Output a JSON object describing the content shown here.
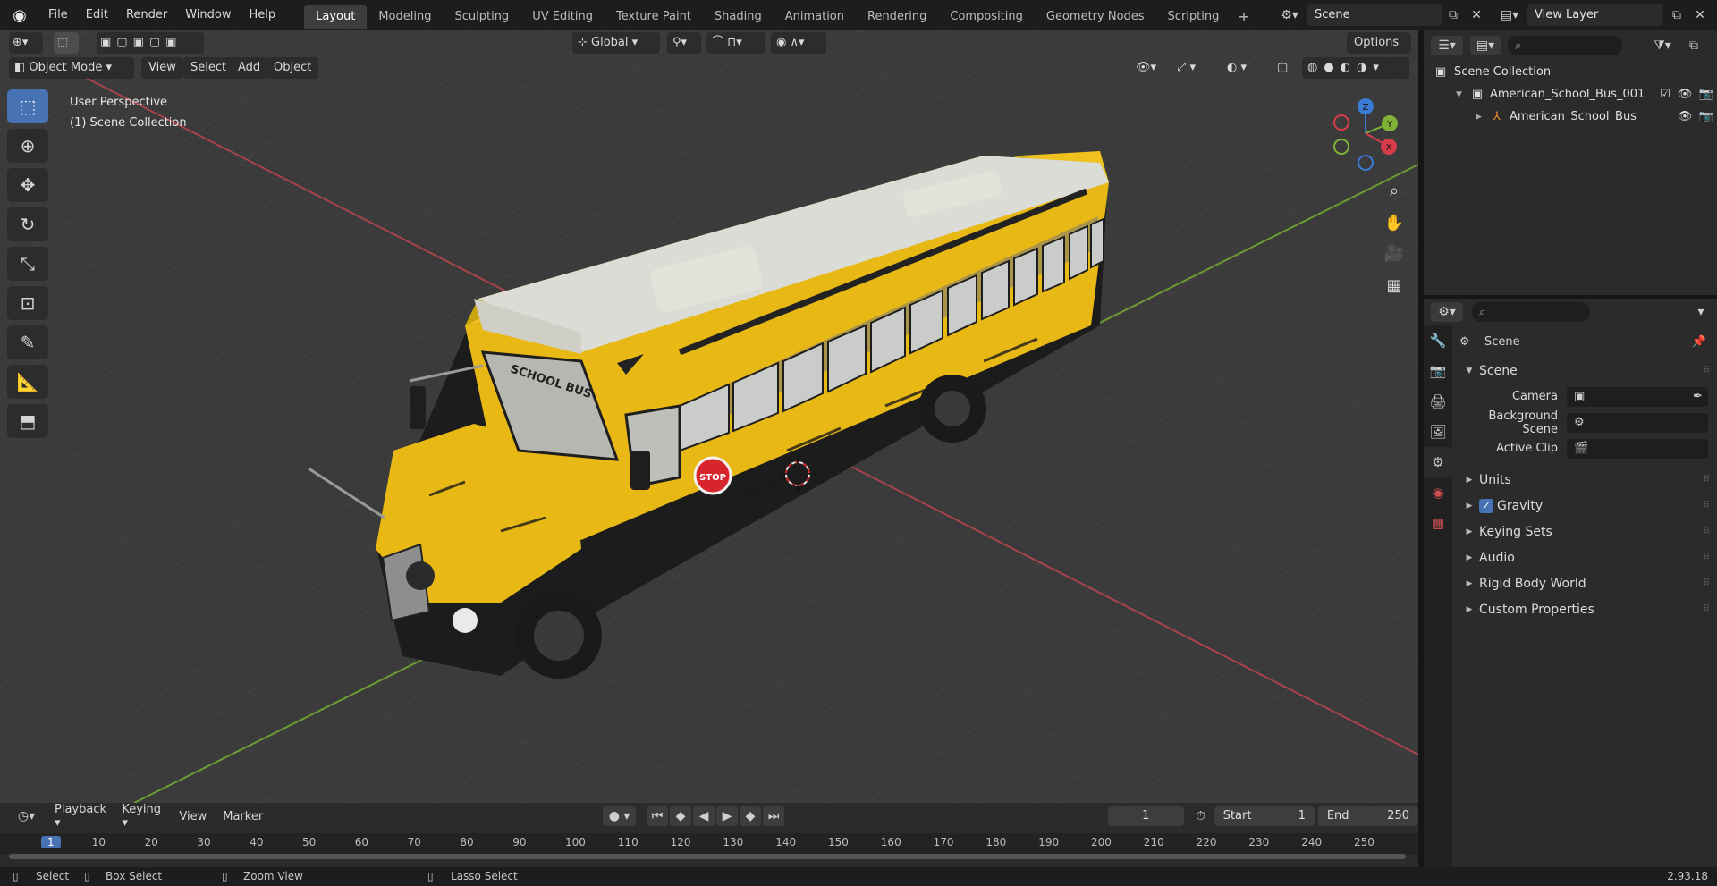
{
  "menu": [
    "File",
    "Edit",
    "Render",
    "Window",
    "Help"
  ],
  "workspaces": [
    "Layout",
    "Modeling",
    "Sculpting",
    "UV Editing",
    "Texture Paint",
    "Shading",
    "Animation",
    "Rendering",
    "Compositing",
    "Geometry Nodes",
    "Scripting"
  ],
  "active_workspace": "Layout",
  "scene_name": "Scene",
  "view_layer": "View Layer",
  "viewport": {
    "transform_orientation": "Global",
    "options_label": "Options",
    "mode": "Object Mode",
    "header_menu": [
      "View",
      "Select",
      "Add",
      "Object"
    ],
    "overlay_title": "User Perspective",
    "overlay_collection": "(1) Scene Collection",
    "axis": {
      "x": "X",
      "y": "Y",
      "z": "Z"
    }
  },
  "outliner": {
    "root": "Scene Collection",
    "items": [
      {
        "name": "American_School_Bus_001",
        "level": 1
      },
      {
        "name": "American_School_Bus",
        "level": 2
      }
    ]
  },
  "properties": {
    "context_name": "Scene",
    "panel_title": "Scene",
    "fields": [
      {
        "label": "Camera",
        "value": ""
      },
      {
        "label": "Background Scene",
        "value": ""
      },
      {
        "label": "Active Clip",
        "value": ""
      }
    ],
    "sections": [
      "Units",
      "Gravity",
      "Keying Sets",
      "Audio",
      "Rigid Body World",
      "Custom Properties"
    ],
    "gravity_checked": true
  },
  "bus": {
    "sign_text": "SCHOOL BUS",
    "stop_text": "STOP"
  },
  "timeline": {
    "menus": [
      "Playback",
      "Keying",
      "View",
      "Marker"
    ],
    "current_frame": "1",
    "start_label": "Start",
    "start": "1",
    "end_label": "End",
    "end": "250",
    "ruler": [
      "1",
      "10",
      "20",
      "30",
      "40",
      "50",
      "60",
      "70",
      "80",
      "90",
      "100",
      "110",
      "120",
      "130",
      "140",
      "150",
      "160",
      "170",
      "180",
      "190",
      "200",
      "210",
      "220",
      "230",
      "240",
      "250"
    ]
  },
  "status": {
    "select": "Select",
    "box_select": "Box Select",
    "zoom_view": "Zoom View",
    "lasso_select": "Lasso Select",
    "version": "2.93.18"
  },
  "colors": {
    "accent": "#4772b3",
    "bus_yellow": "#e8b914",
    "x_axis": "#d63c4a",
    "y_axis": "#7fb338",
    "z_axis": "#3a7bd5"
  }
}
